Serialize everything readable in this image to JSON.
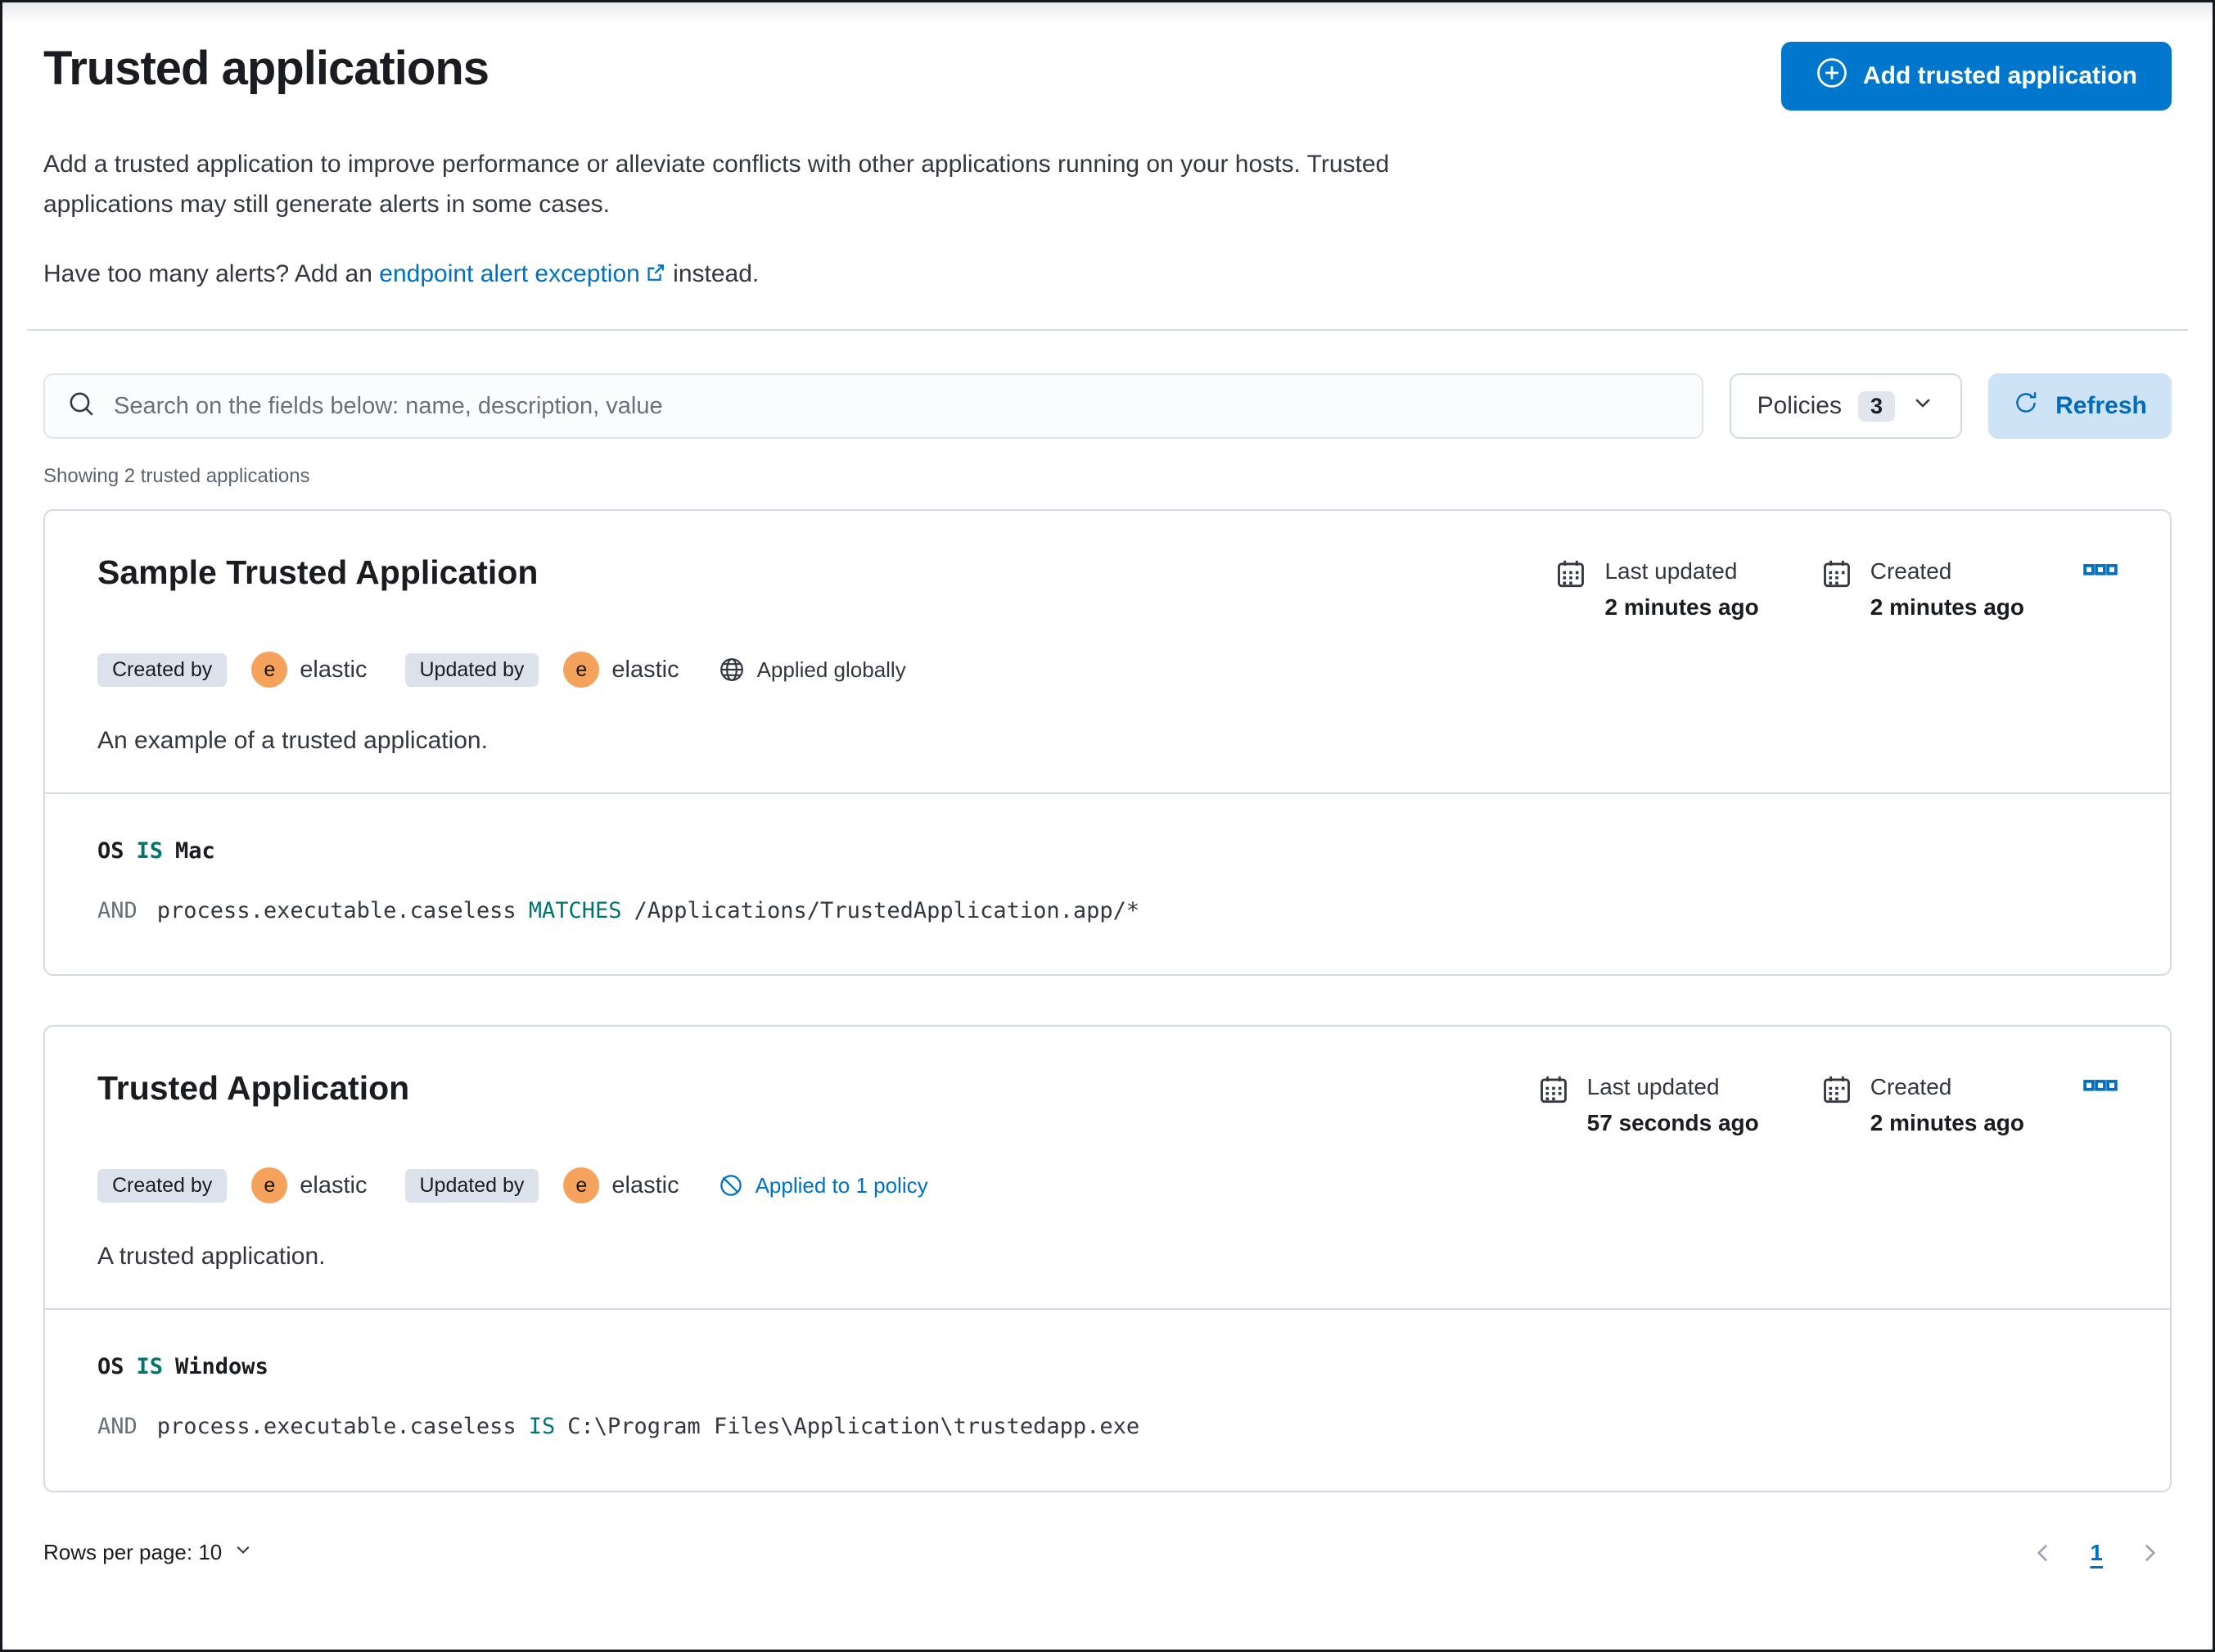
{
  "header": {
    "title": "Trusted applications",
    "add_button_label": "Add trusted application"
  },
  "intro": {
    "description": "Add a trusted application to improve performance or alleviate conflicts with other applications running on your hosts. Trusted applications may still generate alerts in some cases.",
    "alerts_prefix": "Have too many alerts? Add an",
    "alerts_link_label": "endpoint alert exception",
    "alerts_suffix": "instead."
  },
  "toolbar": {
    "search_placeholder": "Search on the fields below: name, description, value",
    "policies_label": "Policies",
    "policies_count": "3",
    "refresh_label": "Refresh"
  },
  "summary_text": "Showing 2 trusted applications",
  "cards": [
    {
      "title": "Sample Trusted Application",
      "created_by_label": "Created by",
      "created_by_avatar": "e",
      "created_by_user": "elastic",
      "updated_by_label": "Updated by",
      "updated_by_avatar": "e",
      "updated_by_user": "elastic",
      "scope_label": "Applied globally",
      "last_updated_label": "Last updated",
      "last_updated_value": "2 minutes ago",
      "created_label": "Created",
      "created_value": "2 minutes ago",
      "description": "An example of a trusted application.",
      "conditions": [
        {
          "field": "OS",
          "operator": "IS",
          "value": "Mac"
        },
        {
          "prefix": "AND",
          "field": "process.executable.caseless",
          "operator": "MATCHES",
          "value": "/Applications/TrustedApplication.app/*"
        }
      ]
    },
    {
      "title": "Trusted Application",
      "created_by_label": "Created by",
      "created_by_avatar": "e",
      "created_by_user": "elastic",
      "updated_by_label": "Updated by",
      "updated_by_avatar": "e",
      "updated_by_user": "elastic",
      "scope_label": "Applied to 1 policy",
      "last_updated_label": "Last updated",
      "last_updated_value": "57 seconds ago",
      "created_label": "Created",
      "created_value": "2 minutes ago",
      "description": "A trusted application.",
      "conditions": [
        {
          "field": "OS",
          "operator": "IS",
          "value": "Windows"
        },
        {
          "prefix": "AND",
          "field": "process.executable.caseless",
          "operator": "IS",
          "value": "C:\\Program Files\\Application\\trustedapp.exe"
        }
      ]
    }
  ],
  "footer": {
    "rows_per_page_label": "Rows per page: 10",
    "current_page": "1"
  },
  "colors": {
    "primary_button": "#0077CC",
    "link_blue": "#0071C2",
    "refresh_button_bg": "#CFE3F6",
    "operator_teal": "#00756F",
    "badge_bg": "#DCE2EC",
    "avatar_orange": "#F5A35C",
    "card_border": "#D3DAE6",
    "text_dark": "#1A1C21",
    "text_body": "#343741",
    "text_subdued": "#69707D"
  }
}
